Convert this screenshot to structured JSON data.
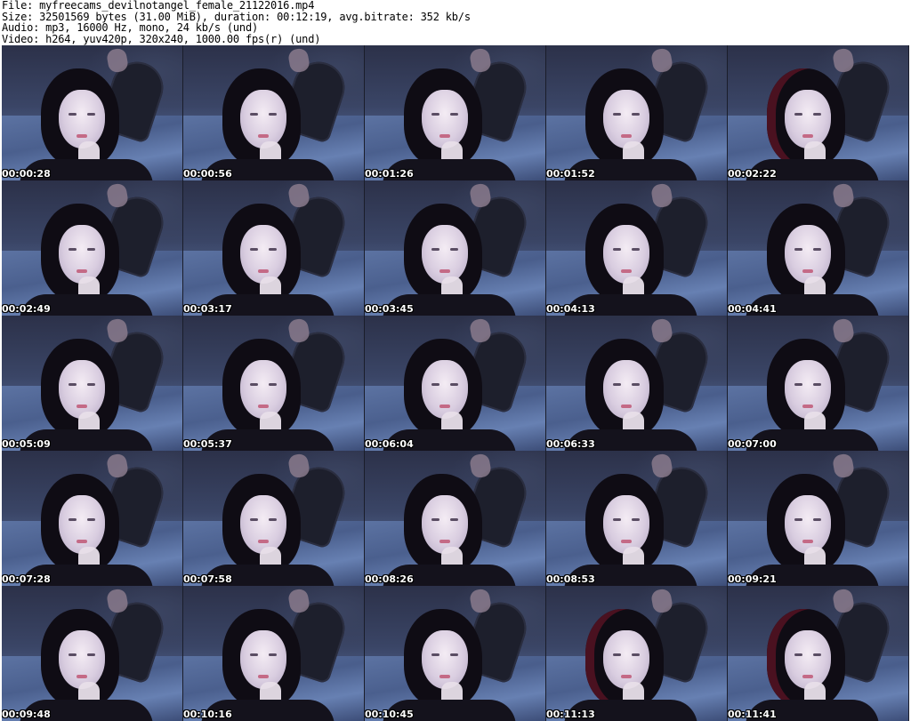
{
  "header": {
    "file_line": "File: myfreecams_devilnotangel_female_21122016.mp4",
    "size_line": "Size: 32501569 bytes (31.00 MiB), duration: 00:12:19, avg.bitrate: 352 kb/s",
    "audio_line": "Audio: mp3, 16000 Hz, mono, 24 kb/s (und)",
    "video_line": "Video: h264, yuv420p, 320x240, 1000.00 fps(r) (und)"
  },
  "thumbnails": [
    {
      "timestamp": "00:00:28",
      "variant": "a"
    },
    {
      "timestamp": "00:00:56",
      "variant": "a"
    },
    {
      "timestamp": "00:01:26",
      "variant": "a"
    },
    {
      "timestamp": "00:01:52",
      "variant": "a"
    },
    {
      "timestamp": "00:02:22",
      "variant": "red"
    },
    {
      "timestamp": "00:02:49",
      "variant": "a"
    },
    {
      "timestamp": "00:03:17",
      "variant": "a"
    },
    {
      "timestamp": "00:03:45",
      "variant": "a"
    },
    {
      "timestamp": "00:04:13",
      "variant": "a"
    },
    {
      "timestamp": "00:04:41",
      "variant": "a"
    },
    {
      "timestamp": "00:05:09",
      "variant": "a"
    },
    {
      "timestamp": "00:05:37",
      "variant": "a"
    },
    {
      "timestamp": "00:06:04",
      "variant": "a"
    },
    {
      "timestamp": "00:06:33",
      "variant": "a"
    },
    {
      "timestamp": "00:07:00",
      "variant": "a"
    },
    {
      "timestamp": "00:07:28",
      "variant": "a"
    },
    {
      "timestamp": "00:07:58",
      "variant": "a"
    },
    {
      "timestamp": "00:08:26",
      "variant": "a"
    },
    {
      "timestamp": "00:08:53",
      "variant": "a"
    },
    {
      "timestamp": "00:09:21",
      "variant": "a"
    },
    {
      "timestamp": "00:09:48",
      "variant": "a"
    },
    {
      "timestamp": "00:10:16",
      "variant": "a"
    },
    {
      "timestamp": "00:10:45",
      "variant": "a"
    },
    {
      "timestamp": "00:11:13",
      "variant": "red"
    },
    {
      "timestamp": "00:11:41",
      "variant": "red"
    }
  ]
}
